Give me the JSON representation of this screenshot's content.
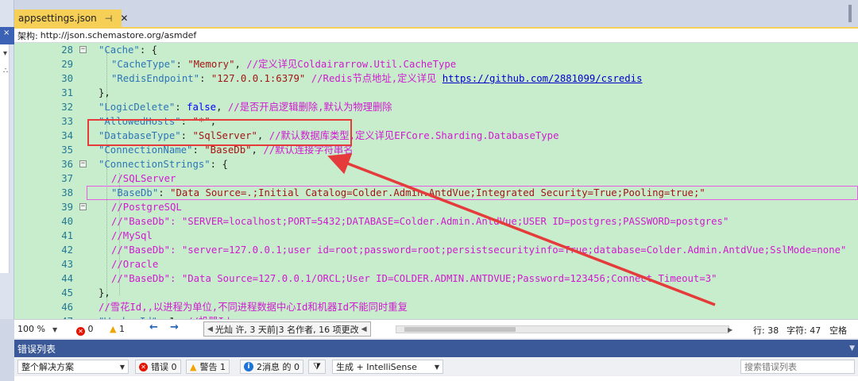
{
  "tab": {
    "title": "appsettings.json",
    "pin_glyph": "⊣",
    "close_glyph": "✕"
  },
  "schema": {
    "label": "架构:",
    "url": "http://json.schemastore.org/asmdef"
  },
  "left_strip": {
    "chars": [
      "×",
      "▸",
      "▾",
      "∴"
    ]
  },
  "editor": {
    "lines": [
      {
        "n": "28",
        "fold": "⊟",
        "parts": [
          [
            "k",
            "\"Cache\""
          ],
          [
            "p",
            ": {"
          ]
        ]
      },
      {
        "n": "29",
        "parts": [
          [
            "p",
            "  "
          ],
          [
            "k",
            "\"CacheType\""
          ],
          [
            "p",
            ": "
          ],
          [
            "s",
            "\"Memory\""
          ],
          [
            "p",
            ", "
          ],
          [
            "c",
            "//定义详见Coldairarrow.Util.CacheType"
          ]
        ]
      },
      {
        "n": "30",
        "parts": [
          [
            "p",
            "  "
          ],
          [
            "k",
            "\"RedisEndpoint\""
          ],
          [
            "p",
            ": "
          ],
          [
            "s",
            "\"127.0.0.1:6379\""
          ],
          [
            "p",
            " "
          ],
          [
            "c",
            "//Redis节点地址,定义详见 "
          ],
          [
            "l",
            "https://github.com/2881099/csredis"
          ]
        ]
      },
      {
        "n": "31",
        "parts": [
          [
            "p",
            "},"
          ]
        ]
      },
      {
        "n": "32",
        "parts": [
          [
            "k",
            "\"LogicDelete\""
          ],
          [
            "p",
            ": "
          ],
          [
            "w",
            "false"
          ],
          [
            "p",
            ", "
          ],
          [
            "c",
            "//是否开启逻辑删除,默认为物理删除"
          ]
        ]
      },
      {
        "n": "33",
        "parts": [
          [
            "k",
            "\"AllowedHosts\""
          ],
          [
            "p",
            ": "
          ],
          [
            "s",
            "\"*\""
          ],
          [
            "p",
            ","
          ]
        ]
      },
      {
        "n": "34",
        "parts": [
          [
            "k",
            "\"DatabaseType\""
          ],
          [
            "p",
            ": "
          ],
          [
            "s",
            "\"SqlServer\""
          ],
          [
            "p",
            ", "
          ],
          [
            "c",
            "//默认数据库类型,定义详见EFCore.Sharding.DatabaseType"
          ]
        ]
      },
      {
        "n": "35",
        "parts": [
          [
            "k",
            "\"ConnectionName\""
          ],
          [
            "p",
            ": "
          ],
          [
            "s",
            "\"BaseDb\""
          ],
          [
            "p",
            ", "
          ],
          [
            "c",
            "//默认连接字符串名"
          ]
        ]
      },
      {
        "n": "36",
        "fold": "⊟",
        "parts": [
          [
            "k",
            "\"ConnectionStrings\""
          ],
          [
            "p",
            ": {"
          ]
        ]
      },
      {
        "n": "37",
        "parts": [
          [
            "p",
            "  "
          ],
          [
            "c",
            "//SQLServer"
          ]
        ]
      },
      {
        "n": "38",
        "parts": [
          [
            "p",
            "  "
          ],
          [
            "k",
            "\"BaseDb\""
          ],
          [
            "p",
            ": "
          ],
          [
            "s",
            "\"Data Source=.;Initial Catalog=Colder.Admin.AntdVue;Integrated Security=True;Pooling=true;\""
          ]
        ]
      },
      {
        "n": "39",
        "fold": "⊟",
        "parts": [
          [
            "p",
            "  "
          ],
          [
            "c",
            "//PostgreSQL"
          ]
        ]
      },
      {
        "n": "40",
        "parts": [
          [
            "p",
            "  "
          ],
          [
            "c",
            "//\"BaseDb\": \"SERVER=localhost;PORT=5432;DATABASE=Colder.Admin.AntdVue;USER ID=postgres;PASSWORD=postgres\""
          ]
        ]
      },
      {
        "n": "41",
        "parts": [
          [
            "p",
            "  "
          ],
          [
            "c",
            "//MySql"
          ]
        ]
      },
      {
        "n": "42",
        "parts": [
          [
            "p",
            "  "
          ],
          [
            "c",
            "//\"BaseDb\": \"server=127.0.0.1;user id=root;password=root;persistsecurityinfo=True;database=Colder.Admin.AntdVue;SslMode=none\""
          ]
        ]
      },
      {
        "n": "43",
        "parts": [
          [
            "p",
            "  "
          ],
          [
            "c",
            "//Oracle"
          ]
        ]
      },
      {
        "n": "44",
        "parts": [
          [
            "p",
            "  "
          ],
          [
            "c",
            "//\"BaseDb\": \"Data Source=127.0.0.1/ORCL;User ID=COLDER.ADMIN.ANTDVUE;Password=123456;Connect Timeout=3\""
          ]
        ]
      },
      {
        "n": "45",
        "parts": [
          [
            "p",
            "},"
          ]
        ]
      },
      {
        "n": "46",
        "parts": [
          [
            "c",
            "//雪花Id,,以进程为单位,不同进程数据中心Id和机器Id不能同时重复"
          ]
        ]
      },
      {
        "n": "47",
        "parts": [
          [
            "k",
            "\"WorkerId\""
          ],
          [
            "p",
            ": 1, "
          ],
          [
            "c",
            "//机器Id"
          ]
        ]
      }
    ]
  },
  "status": {
    "zoom": "100 %",
    "errors": "0",
    "warnings": "1",
    "back_arrow": "←",
    "forward_arrow": "→",
    "git_text": "光灿 许, 3 天前|3 名作者, 16 项更改",
    "line_info": "行: 38",
    "col_info": "字符: 47",
    "mode_info": "空格"
  },
  "error_list": {
    "title": "错误列表",
    "scope": "整个解决方案",
    "errors_label": "错误 0",
    "warnings_label": "警告 1",
    "messages_label": "2消息 的 0",
    "filter_icon_glyph": "⧩",
    "build_option": "生成 + IntelliSense",
    "search_placeholder": "搜索错误列表"
  },
  "colors": {
    "tab_active": "#f6cf57",
    "editor_bg": "#c7edcc",
    "json_key": "#2e75b6",
    "json_string": "#a31515",
    "comment": "#d01ad0",
    "annotation_red": "#e53b3b",
    "panel_title_bg": "#3b5998"
  }
}
